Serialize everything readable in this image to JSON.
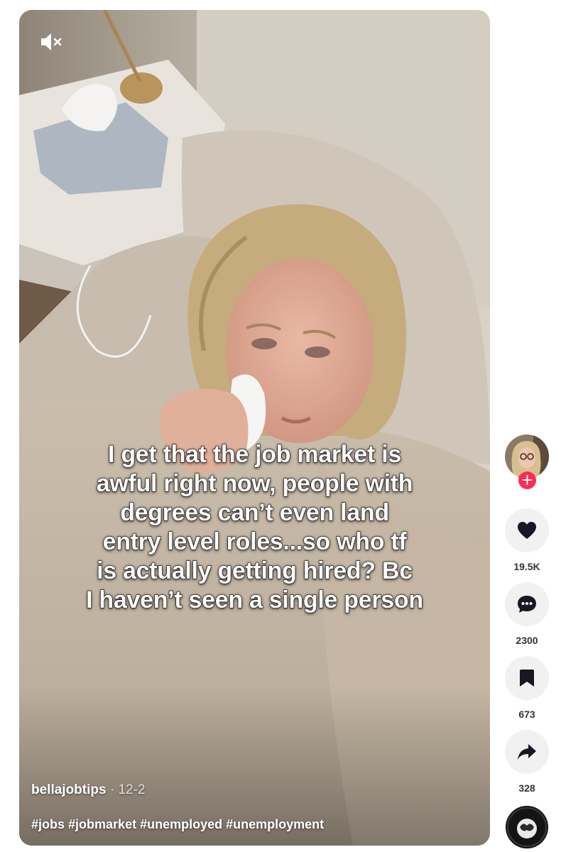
{
  "video": {
    "caption_lines": [
      "I get that the job market is",
      "awful right now, people with",
      "degrees can’t even land",
      "entry level roles...so who tf",
      "is actually getting hired? Bc",
      "I haven’t seen a single person"
    ],
    "author": "bellajobtips",
    "separator": "·",
    "date": "12-2",
    "hashtags": [
      "#jobs",
      "#jobmarket",
      "#unemployed",
      "#unemployment"
    ],
    "mute_icon": "speaker-muted-icon"
  },
  "actions": {
    "follow_label": "+",
    "likes": "19.5K",
    "comments": "2300",
    "saves": "673",
    "shares": "328",
    "icons": {
      "like": "heart-icon",
      "comment": "speech-bubble-icon",
      "save": "bookmark-icon",
      "share": "share-arrow-icon",
      "music": "music-disc-icon"
    }
  },
  "colors": {
    "follow_accent": "#fe2c55",
    "action_bg": "#f1f1f2",
    "count_text": "#333333"
  }
}
